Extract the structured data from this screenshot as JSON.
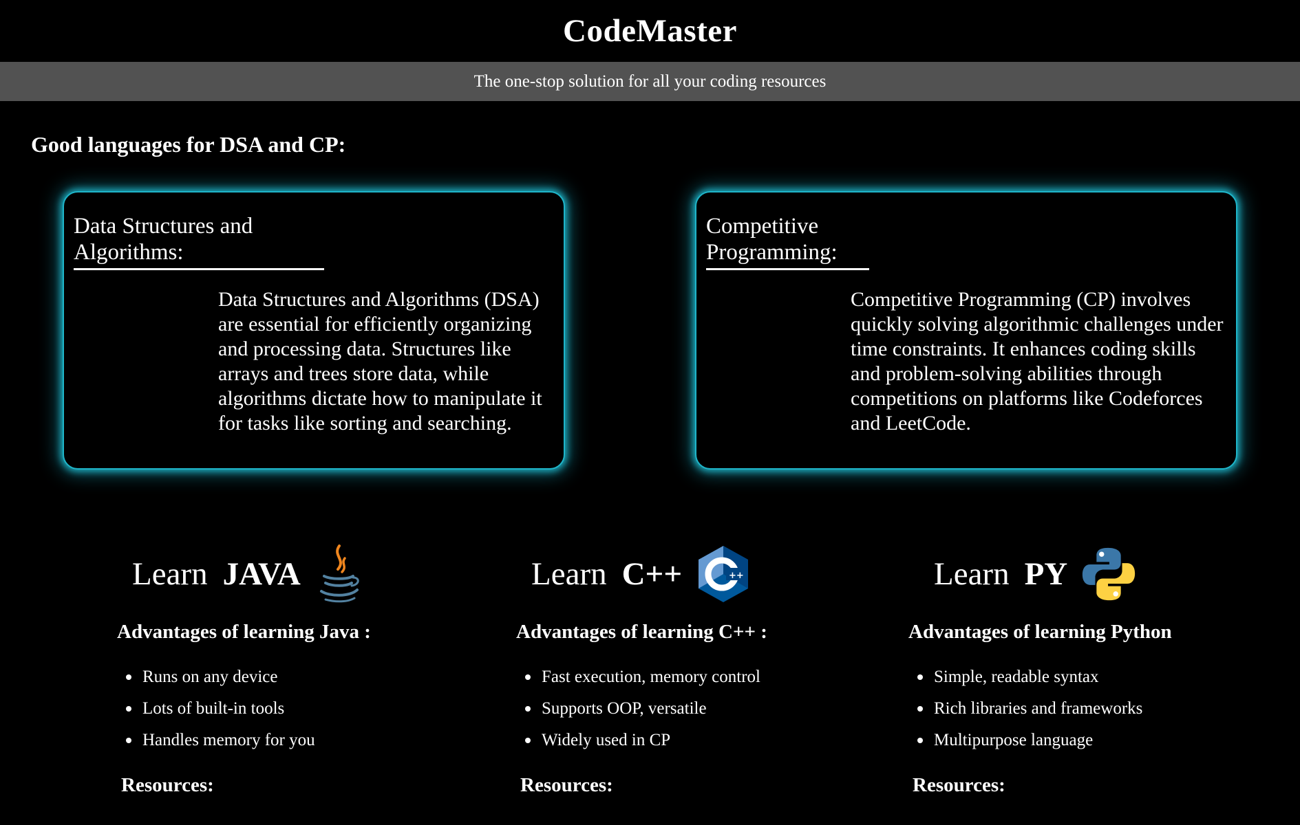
{
  "header": {
    "title": "CodeMaster",
    "tagline": "The one-stop solution for all your coding resources"
  },
  "intro": {
    "heading": "Good languages for DSA and CP:"
  },
  "cards": [
    {
      "title": "Data Structures and Algorithms:",
      "body": "Data Structures and Algorithms (DSA) are essential for efficiently organizing and processing data. Structures like arrays and trees store data, while algorithms dictate how to manipulate it for tasks like sorting and searching."
    },
    {
      "title": "Competitive Programming:",
      "body": "Competitive Programming (CP) involves quickly solving algorithmic challenges under time constraints. It enhances coding skills and problem-solving abilities through competitions on platforms like Codeforces and LeetCode."
    }
  ],
  "languages": [
    {
      "learn": "Learn",
      "name": "JAVA",
      "icon": "java-icon",
      "advantages_heading": "Advantages of learning Java :",
      "advantages": [
        "Runs on any device",
        "Lots of built-in tools",
        "Handles memory for you"
      ],
      "resources_heading": "Resources:"
    },
    {
      "learn": "Learn",
      "name": "C++",
      "icon": "cpp-icon",
      "advantages_heading": "Advantages of learning C++ :",
      "advantages": [
        "Fast execution, memory control",
        "Supports OOP, versatile",
        "Widely used in CP"
      ],
      "resources_heading": "Resources:"
    },
    {
      "learn": "Learn",
      "name": "PY",
      "icon": "python-icon",
      "advantages_heading": "Advantages of learning Python",
      "advantages": [
        "Simple, readable syntax",
        "Rich libraries and frameworks",
        "Multipurpose language"
      ],
      "resources_heading": "Resources:"
    }
  ],
  "colors": {
    "background": "#000000",
    "tagline_bar": "#525252",
    "card_glow": "#1fb5c9"
  }
}
